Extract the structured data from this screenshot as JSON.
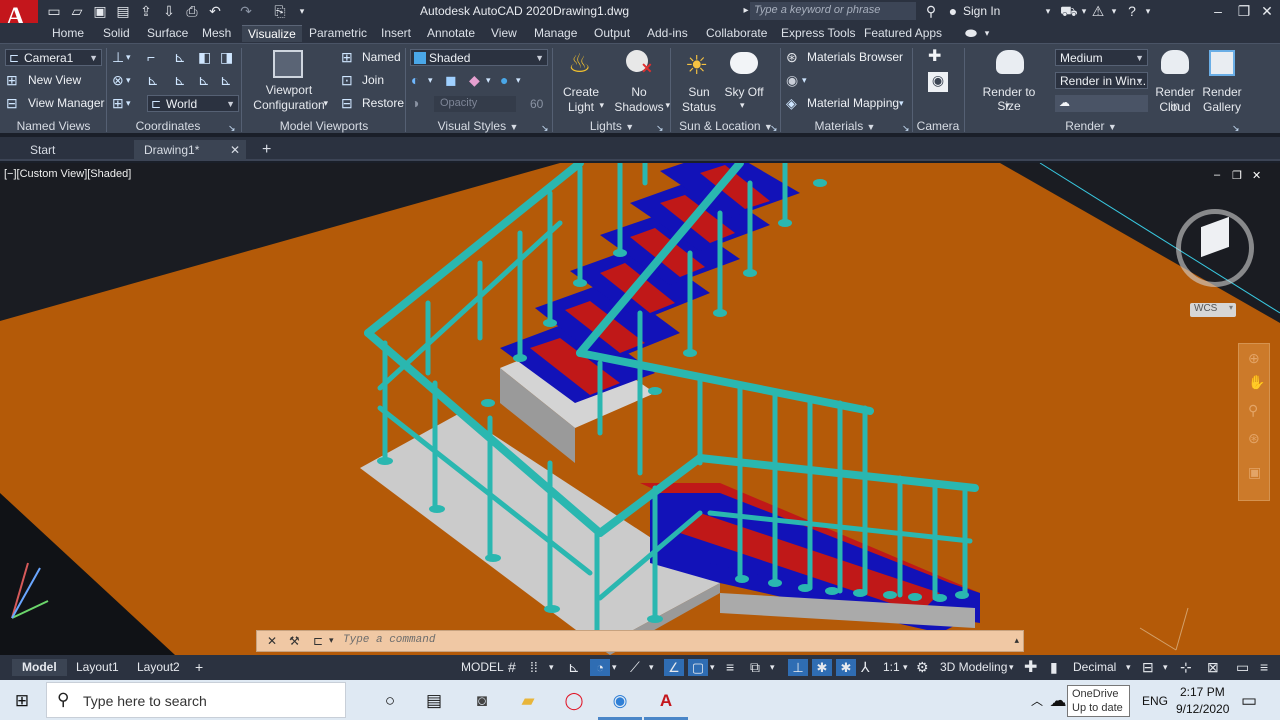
{
  "titlebar": {
    "app_title": "Autodesk AutoCAD 2020",
    "file_name": "Drawing1.dwg",
    "search_placeholder": "Type a keyword or phrase",
    "sign_in": "Sign In",
    "app_logo_letter": "A"
  },
  "ribbon_tabs": [
    "Home",
    "Solid",
    "Surface",
    "Mesh",
    "Visualize",
    "Parametric",
    "Insert",
    "Annotate",
    "View",
    "Manage",
    "Output",
    "Add-ins",
    "Collaborate",
    "Express Tools",
    "Featured Apps"
  ],
  "active_tab": "Visualize",
  "ribbon": {
    "named_views": {
      "camera_dropdown": "Camera1",
      "new_view": "New View",
      "view_manager": "View Manager",
      "label": "Named Views"
    },
    "coordinates": {
      "ucs_dropdown": "World",
      "label": "Coordinates"
    },
    "model_viewports": {
      "viewport_config_line1": "Viewport",
      "viewport_config_line2": "Configuration",
      "named": "Named",
      "join": "Join",
      "restore": "Restore",
      "label": "Model Viewports"
    },
    "visual_styles": {
      "style_dropdown": "Shaded",
      "opacity_placeholder": "Opacity",
      "opacity_value": "60",
      "label": "Visual Styles"
    },
    "lights": {
      "create_light_line1": "Create",
      "create_light_line2": "Light",
      "no_shadows_line1": "No",
      "no_shadows_line2": "Shadows",
      "label": "Lights"
    },
    "sun_location": {
      "sun_status_line1": "Sun",
      "sun_status_line2": "Status",
      "sky_off": "Sky Off",
      "label": "Sun & Location"
    },
    "materials": {
      "materials_browser": "Materials Browser",
      "material_mapping": "Material Mapping",
      "label": "Materials"
    },
    "camera": {
      "label": "Camera"
    },
    "render": {
      "render_to_size": "Render to Size",
      "quality_dropdown": "Medium",
      "render_in_dropdown": "Render in Win...",
      "render_in_cloud_line1": "Render in",
      "render_in_cloud_line2": "Cloud",
      "render_gallery_line1": "Render",
      "render_gallery_line2": "Gallery",
      "label": "Render"
    }
  },
  "doc_tabs": {
    "start": "Start",
    "drawing": "Drawing1*"
  },
  "viewport": {
    "label": "[−][Custom View][Shaded]",
    "wcs": "WCS",
    "command_placeholder": "Type  a  command"
  },
  "statusbar": {
    "layout_tabs": [
      "Model",
      "Layout1",
      "Layout2"
    ],
    "model_button": "MODEL",
    "scale": "1:1",
    "workspace": "3D Modeling",
    "units": "Decimal"
  },
  "taskbar": {
    "search_placeholder": "Type here to search",
    "onedrive_line1": "OneDrive",
    "onedrive_line2": "Up to date",
    "language": "ENG",
    "time": "2:17 PM",
    "date": "9/12/2020"
  },
  "colors": {
    "ground": "#b45a08",
    "railing": "#2ab7b0",
    "tread_blue": "#1212b8",
    "tread_red": "#c01818",
    "landing": "#c8c8c8",
    "ribbon_bg": "#3b4453"
  }
}
